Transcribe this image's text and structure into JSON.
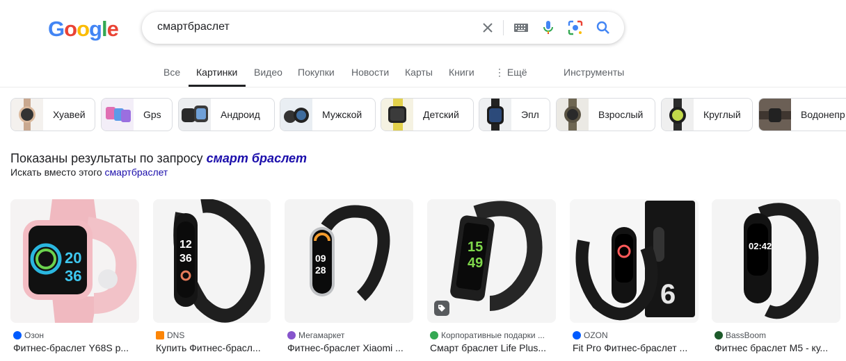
{
  "logo": {
    "letters": [
      "G",
      "o",
      "o",
      "g",
      "l",
      "e"
    ],
    "colors": [
      "#4285F4",
      "#EA4335",
      "#FBBC05",
      "#4285F4",
      "#34A853",
      "#EA4335"
    ]
  },
  "search": {
    "query": "смартбраслет"
  },
  "tabs": [
    {
      "label": "Все"
    },
    {
      "label": "Картинки"
    },
    {
      "label": "Видео"
    },
    {
      "label": "Покупки"
    },
    {
      "label": "Новости"
    },
    {
      "label": "Карты"
    },
    {
      "label": "Книги"
    },
    {
      "label": "⋮ Ещё"
    },
    {
      "label": "Инструменты"
    }
  ],
  "chips": [
    {
      "label": "Хуавей",
      "thumb": "#c9b7a8"
    },
    {
      "label": "Gps",
      "thumb": "#d9c6e6"
    },
    {
      "label": "Андроид",
      "thumb": "#cfd2d6"
    },
    {
      "label": "Мужской",
      "thumb": "#b7c9d9"
    },
    {
      "label": "Детский",
      "thumb": "#e3d76a"
    },
    {
      "label": "Эпл",
      "thumb": "#cfd1d4"
    },
    {
      "label": "Взрослый",
      "thumb": "#8a8370"
    },
    {
      "label": "Круглый",
      "thumb": "#d2d4d6"
    },
    {
      "label": "Водонепр",
      "thumb": "#6b5f55"
    }
  ],
  "notice": {
    "showing_prefix": "Показаны результаты по запросу",
    "showing_query": "смарт браслет",
    "instead_prefix": "Искать вместо этого",
    "instead_link": "смартбраслет"
  },
  "results": [
    {
      "source": "Озон",
      "title": "Фитнес-браслет Y68S р...",
      "favicon": "#005bff",
      "band": "#f0b3bb"
    },
    {
      "source": "DNS",
      "title": "Купить Фитнес-брасл...",
      "favicon": "#fc8507",
      "band": "#1f1f1f"
    },
    {
      "source": "Мегамаркет",
      "title": "Фитнес-браслет Xiaomi ...",
      "favicon": "#8654cc",
      "band": "#1f1f1f"
    },
    {
      "source": "Корпоративные подарки ...",
      "title": "Смарт браслет Life Plus...",
      "favicon": "#34a853",
      "band": "#222"
    },
    {
      "source": "OZON",
      "title": "Fit Pro Фитнес-браслет ...",
      "favicon": "#005bff",
      "band": "#1a1a1a"
    },
    {
      "source": "BassBoom",
      "title": "Фитнес браслет М5 - ку...",
      "favicon": "#1d5a2a",
      "band": "#1a1a1a"
    }
  ]
}
